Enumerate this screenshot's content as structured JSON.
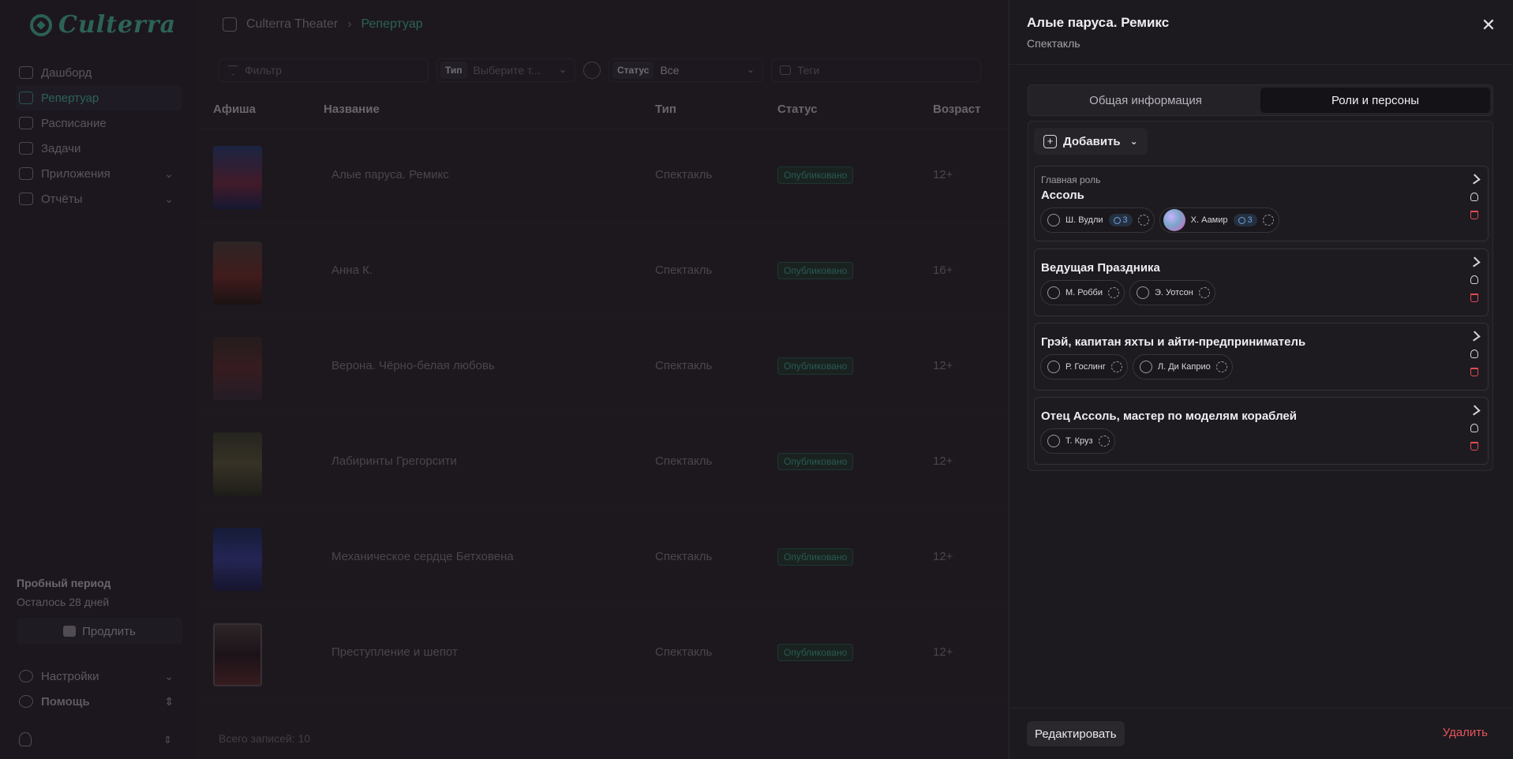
{
  "app": {
    "logo_text": "Culterra"
  },
  "sidebar": {
    "items": [
      {
        "label": "Дашборд",
        "icon": "home-icon"
      },
      {
        "label": "Репертуар",
        "icon": "film-icon",
        "active": true
      },
      {
        "label": "Расписание",
        "icon": "calendar-icon"
      },
      {
        "label": "Задачи",
        "icon": "tasks-icon"
      },
      {
        "label": "Приложения",
        "icon": "apps-icon",
        "expandable": true
      },
      {
        "label": "Отчёты",
        "icon": "reports-icon",
        "expandable": true
      }
    ],
    "trial": {
      "title": "Пробный период",
      "remaining": "Осталось 28 дней",
      "extend_label": "Продлить"
    },
    "bottom": [
      {
        "label": "Настройки",
        "icon": "gear-icon"
      },
      {
        "label": "Помощь",
        "icon": "help-icon"
      }
    ]
  },
  "header": {
    "breadcrumb": [
      "Culterra Theater",
      "Репертуар"
    ]
  },
  "filters": {
    "search_placeholder": "Фильтр",
    "type_label": "Тип",
    "type_placeholder": "Выберите т...",
    "status_label": "Статус",
    "status_value": "Все",
    "tags_placeholder": "Теги"
  },
  "table": {
    "columns": [
      "Афиша",
      "Название",
      "Тип",
      "Статус",
      "Возраст"
    ],
    "rows": [
      {
        "title": "Алые паруса. Ремикс",
        "type": "Спектакль",
        "status": "Опубликовано",
        "age": "12+"
      },
      {
        "title": "Анна К.",
        "type": "Спектакль",
        "status": "Опубликовано",
        "age": "16+"
      },
      {
        "title": "Верона. Чёрно-белая любовь",
        "type": "Спектакль",
        "status": "Опубликовано",
        "age": "12+"
      },
      {
        "title": "Лабиринты Грегорсити",
        "type": "Спектакль",
        "status": "Опубликовано",
        "age": "12+"
      },
      {
        "title": "Механическое сердце Бетховена",
        "type": "Спектакль",
        "status": "Опубликовано",
        "age": "12+"
      },
      {
        "title": "Преступление и шепот",
        "type": "Спектакль",
        "status": "Опубликовано",
        "age": "12+"
      }
    ],
    "total": "Всего записей: 10"
  },
  "drawer": {
    "title": "Алые паруса. Ремикс",
    "subtitle": "Спектакль",
    "tabs": [
      "Общая информация",
      "Роли и персоны"
    ],
    "active_tab": 1,
    "add_label": "Добавить",
    "roles": [
      {
        "label": "Главная роль",
        "name": "Ассоль",
        "persons": [
          {
            "name": "Ш. Вудли",
            "count": "3",
            "photo": false
          },
          {
            "name": "Х. Аамир",
            "count": "3",
            "photo": true
          }
        ]
      },
      {
        "label": "",
        "name": "Ведущая Праздника",
        "persons": [
          {
            "name": "М. Робби"
          },
          {
            "name": "Э. Уотсон"
          }
        ]
      },
      {
        "label": "",
        "name": "Грэй, капитан яхты и айти-предприниматель",
        "persons": [
          {
            "name": "Р. Гослинг"
          },
          {
            "name": "Л. Ди Каприо"
          }
        ]
      },
      {
        "label": "",
        "name": "Отец Ассоль, мастер по моделям кораблей",
        "persons": [
          {
            "name": "Т. Круз"
          }
        ]
      }
    ],
    "edit_label": "Редактировать",
    "delete_label": "Удалить"
  },
  "colors": {
    "accent": "#46a994",
    "danger": "#e8545b",
    "badge_blue": "#6fa0e6"
  }
}
